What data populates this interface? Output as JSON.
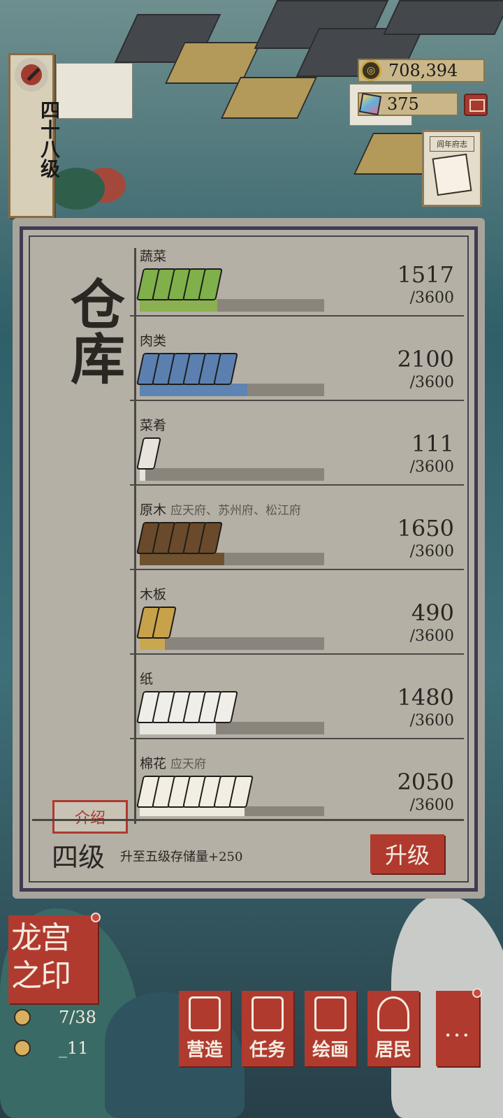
{
  "header": {
    "level_label": "四十八级",
    "coins": "708,394",
    "gems": "375",
    "chronicle_label": "闾年府志"
  },
  "warehouse": {
    "title": "仓库",
    "intro_button": "介绍",
    "items": [
      {
        "name": "蔬菜",
        "sub": "",
        "amount": "1517",
        "cap": "/3600",
        "fraction": 0.421,
        "color": "#8bb050",
        "icon_count": 5,
        "icon_color": "#7fb04a"
      },
      {
        "name": "肉类",
        "sub": "",
        "amount": "2100",
        "cap": "/3600",
        "fraction": 0.583,
        "color": "#5d84b2",
        "icon_count": 6,
        "icon_color": "#5b80b0"
      },
      {
        "name": "菜肴",
        "sub": "",
        "amount": "111",
        "cap": "/3600",
        "fraction": 0.031,
        "color": "#e8e4dc",
        "icon_count": 1,
        "icon_color": "#e8e4dc"
      },
      {
        "name": "原木",
        "sub": "应天府、苏州府、松江府",
        "amount": "1650",
        "cap": "/3600",
        "fraction": 0.458,
        "color": "#6e5230",
        "icon_count": 5,
        "icon_color": "#6a4a2a"
      },
      {
        "name": "木板",
        "sub": "",
        "amount": "490",
        "cap": "/3600",
        "fraction": 0.136,
        "color": "#c9a750",
        "icon_count": 2,
        "icon_color": "#c8a24a"
      },
      {
        "name": "纸",
        "sub": "",
        "amount": "1480",
        "cap": "/3600",
        "fraction": 0.411,
        "color": "#e8e6e0",
        "icon_count": 6,
        "icon_color": "#f0eee8"
      },
      {
        "name": "棉花",
        "sub": "应天府",
        "amount": "2050",
        "cap": "/3600",
        "fraction": 0.569,
        "color": "#eeeae0",
        "icon_count": 7,
        "icon_color": "#f2eee4"
      }
    ],
    "level": "四级",
    "upgrade_desc": "升至五级存储量+250",
    "upgrade_button": "升级"
  },
  "seal": {
    "title_line1": "龙宫",
    "title_line2": "之印",
    "stat1": "7/38",
    "stat2": "_11"
  },
  "menu": {
    "build": "营造",
    "tasks": "任务",
    "paint": "绘画",
    "residents": "居民",
    "more": "..."
  }
}
